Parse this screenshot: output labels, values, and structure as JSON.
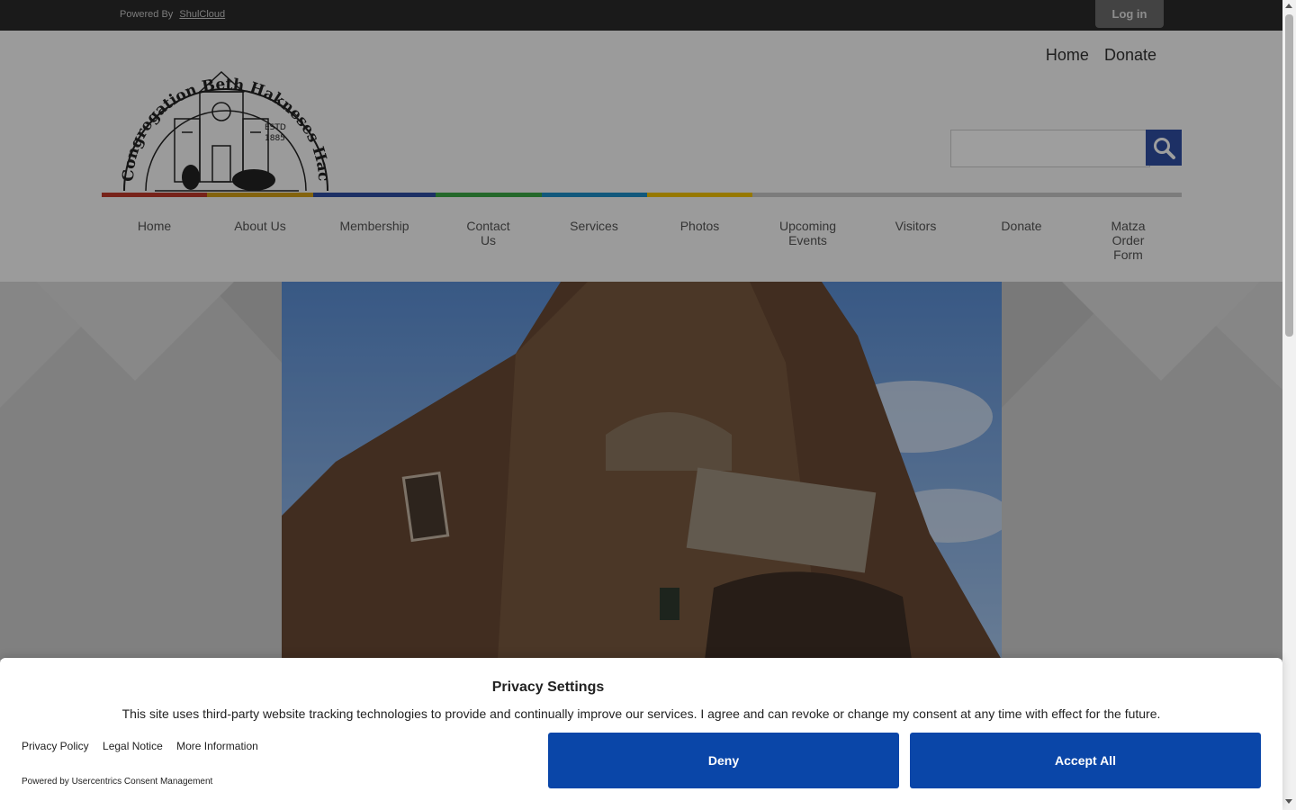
{
  "topbar": {
    "powered_prefix": "Powered By",
    "powered_link": "ShulCloud",
    "login_label": "Log in"
  },
  "header": {
    "logo_title": "Congregation Beth Hakneses Hachodosh",
    "logo_estd": "ESTD",
    "logo_year": "1885",
    "util_nav": [
      "Home",
      "Donate"
    ],
    "search_placeholder": "",
    "rainbow_colors": [
      "#c0392b",
      "#d4a017",
      "#2f4ea3",
      "#3aa845",
      "#1d8ec9",
      "#f2c200",
      "#c8c8c8"
    ]
  },
  "main_nav": [
    {
      "label": "Home"
    },
    {
      "label": "About Us"
    },
    {
      "label": "Membership"
    },
    {
      "label": "Contact\nUs"
    },
    {
      "label": "Services"
    },
    {
      "label": "Photos"
    },
    {
      "label": "Upcoming\nEvents"
    },
    {
      "label": "Visitors"
    },
    {
      "label": "Donate"
    },
    {
      "label": "Matza\nOrder\nForm"
    }
  ],
  "consent": {
    "title": "Privacy Settings",
    "text": "This site uses third-party website tracking technologies to provide and continually improve our services. I agree and can revoke or change my consent at any time with effect for the future.",
    "links": [
      "Privacy Policy",
      "Legal Notice",
      "More Information"
    ],
    "powered": "Powered by Usercentrics Consent Management",
    "deny_label": "Deny",
    "accept_label": "Accept All",
    "button_color": "#0a46a8"
  },
  "colors": {
    "topbar": "#2a2a2a",
    "search_button": "#2f4ea3"
  }
}
